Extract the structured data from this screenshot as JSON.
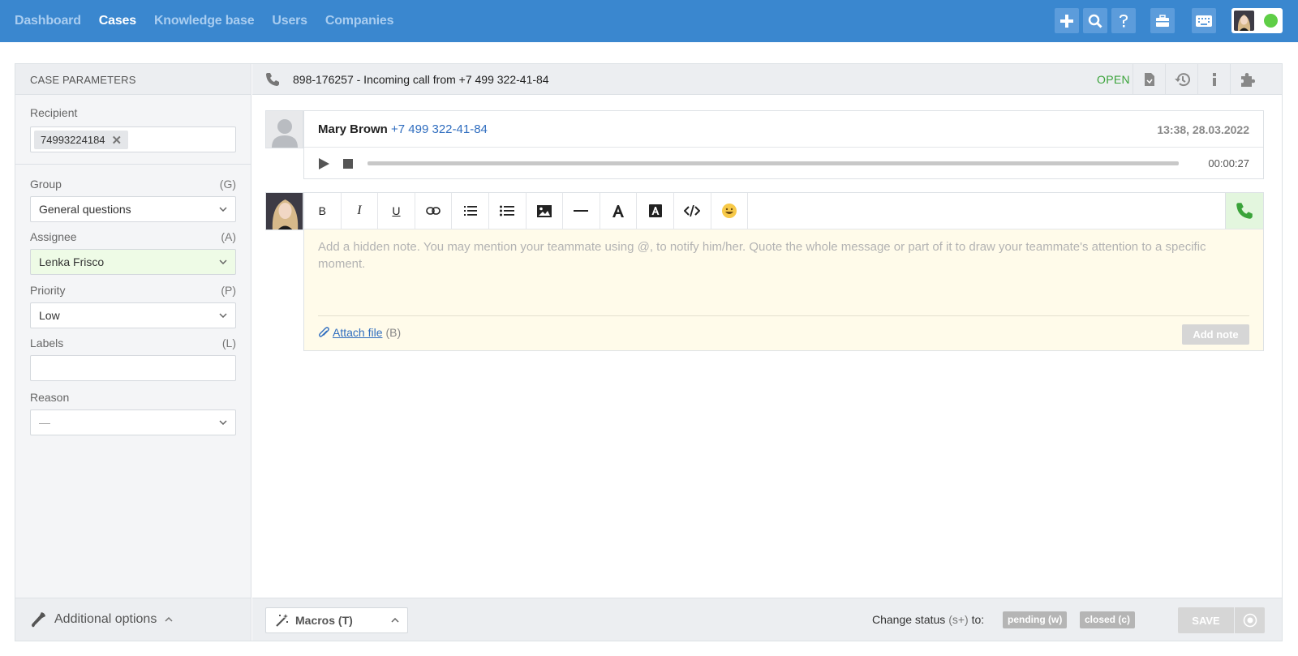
{
  "nav": {
    "items": [
      {
        "label": "Dashboard"
      },
      {
        "label": "Cases"
      },
      {
        "label": "Knowledge base"
      },
      {
        "label": "Users"
      },
      {
        "label": "Companies"
      }
    ],
    "active": "Cases"
  },
  "topbar_icons": [
    "plus-icon",
    "search-icon",
    "help-icon",
    "briefcase-icon",
    "keyboard-icon"
  ],
  "colors": {
    "topbar": "#3a87cf",
    "accent_link": "#2f6dbf",
    "open_status": "#3aa33a",
    "online": "#5fce47",
    "assignee_bg": "#eefbe6",
    "note_bg": "#fffbea"
  },
  "left": {
    "header": "CASE PARAMETERS",
    "recipient": {
      "label": "Recipient",
      "tag": "74993224184",
      "remove": "✕"
    },
    "group": {
      "label": "Group",
      "key": "(G)",
      "value": "General questions"
    },
    "assignee": {
      "label": "Assignee",
      "key": "(A)",
      "value": "Lenka Frisco"
    },
    "priority": {
      "label": "Priority",
      "key": "(P)",
      "value": "Low"
    },
    "labels": {
      "label": "Labels",
      "key": "(L)",
      "value": ""
    },
    "reason": {
      "label": "Reason",
      "value": "—"
    },
    "footer": "Additional options"
  },
  "case": {
    "title": "898-176257 - Incoming call from +7 499 322-41-84",
    "status": "OPEN",
    "header_icons": [
      "document-icon",
      "history-icon",
      "info-icon",
      "plugin-icon"
    ]
  },
  "message": {
    "name": "Mary Brown",
    "phone": "+7 499 322-41-84",
    "datetime": "13:38, 28.03.2022",
    "duration": "00:00:27"
  },
  "editor": {
    "tools": [
      "B",
      "I",
      "U",
      "link-icon",
      "ordered-list-icon",
      "bullet-list-icon",
      "image-icon",
      "horizontal-rule-icon",
      "font-color-icon",
      "font-bg-icon",
      "code-icon",
      "emoji-icon"
    ],
    "placeholder": "Add a hidden note. You may mention your teammate using @, to notify him/her. Quote the whole message or part of it to draw your teammate's attention to a specific moment.",
    "attach": "Attach file",
    "attach_key": "(B)",
    "add_note": "Add note"
  },
  "footer": {
    "macros": "Macros (T)",
    "change_status": "Change status",
    "change_status_key": "(s+)",
    "change_status_to": "to:",
    "pending": "pending (w)",
    "closed": "closed (c)",
    "save": "SAVE"
  }
}
